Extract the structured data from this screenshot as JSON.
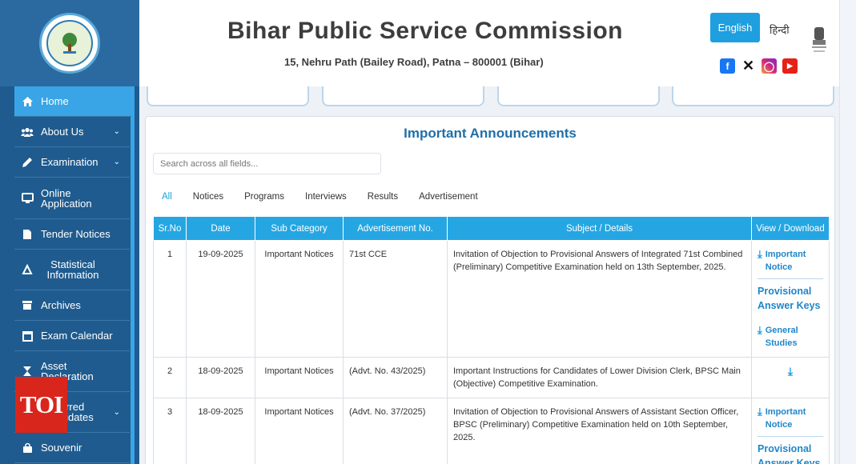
{
  "header": {
    "title": "Bihar Public Service Commission",
    "address": "15, Nehru Path (Bailey Road), Patna – 800001 (Bihar)",
    "lang_en": "English",
    "lang_hi": "हिन्दी"
  },
  "sidebar": {
    "items": [
      {
        "label": "Home",
        "icon": "home-icon"
      },
      {
        "label": "About Us",
        "icon": "users-icon"
      },
      {
        "label": "Examination",
        "icon": "pencil-icon"
      },
      {
        "label": "Online Application",
        "icon": "monitor-icon"
      },
      {
        "label": "Tender Notices",
        "icon": "document-icon"
      },
      {
        "label": "Statistical Information",
        "icon": "chart-icon"
      },
      {
        "label": "Archives",
        "icon": "archive-icon"
      },
      {
        "label": "Exam Calendar",
        "icon": "calendar-icon"
      },
      {
        "label": "Asset Declaration",
        "icon": "hourglass-icon"
      },
      {
        "label": "Debarred Candidates",
        "icon": "user-x-icon"
      },
      {
        "label": "Souvenir",
        "icon": "bag-icon"
      }
    ]
  },
  "watermark": "TOI",
  "main": {
    "title": "Important Announcements",
    "search_placeholder": "Search across all fields...",
    "tabs": [
      "All",
      "Notices",
      "Programs",
      "Interviews",
      "Results",
      "Advertisement"
    ],
    "columns": [
      "Sr.No",
      "Date",
      "Sub Category",
      "Advertisement No.",
      "Subject / Details",
      "View / Download"
    ],
    "rows": [
      {
        "sr": "1",
        "date": "19-09-2025",
        "category": "Important Notices",
        "adv": "71st CCE",
        "subject": "Invitation of Objection to Provisional Answers of Integrated 71st Combined (Preliminary) Competitive Examination held on 13th September, 2025.",
        "download": "Important Notice",
        "section": "Provisional Answer Keys",
        "sub_download": "General Studies"
      },
      {
        "sr": "2",
        "date": "18-09-2025",
        "category": "Important Notices",
        "adv": "(Advt. No. 43/2025)",
        "subject": "Important Instructions for Candidates of Lower Division Clerk, BPSC Main (Objective) Competitive Examination."
      },
      {
        "sr": "3",
        "date": "18-09-2025",
        "category": "Important Notices",
        "adv": "(Advt. No. 37/2025)",
        "subject": "Invitation of Objection to Provisional Answers of Assistant Section Officer, BPSC (Preliminary) Competitive Examination held on 10th September, 2025.",
        "download": "Important Notice",
        "section": "Provisional Answer Keys"
      }
    ]
  }
}
